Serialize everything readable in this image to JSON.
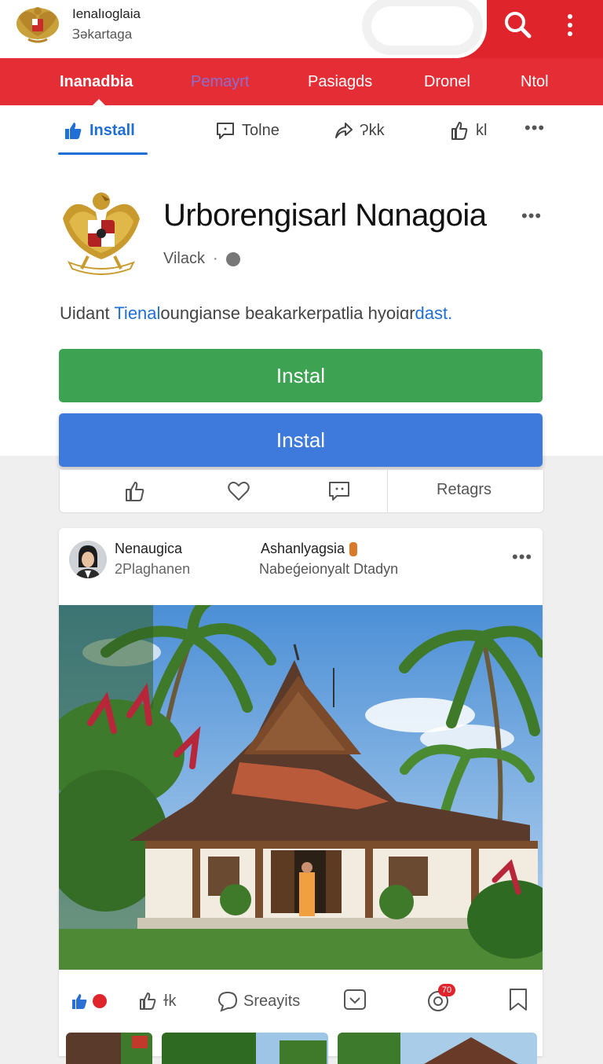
{
  "header": {
    "site_title": "Ienalıoglaia",
    "site_subtitle": "Ɜəkartaga"
  },
  "nav": {
    "items": [
      "Inanadbia",
      "Pemayrt",
      "Pasiagds",
      "Dronel",
      "Ntol"
    ]
  },
  "tabs": [
    {
      "label": "Install",
      "icon": "thumbs-up-icon"
    },
    {
      "label": "Tolne",
      "icon": "comment-icon"
    },
    {
      "label": "Ɂkk",
      "icon": "share-icon"
    },
    {
      "label": "kl",
      "icon": "thumbs-up-icon"
    }
  ],
  "profile": {
    "title": "Urborengisarl Nɑnagoia",
    "subtitle": "Vilack",
    "description_prefix": "Uidant ",
    "description_highlight": "Tienal",
    "description_middle": "oungianse beakarkerpatlia hyoiɑr",
    "description_suffix": "dast."
  },
  "buttons": {
    "install_primary": "Instal",
    "install_secondary": "Instal"
  },
  "action_bar": {
    "label": "Retagrs"
  },
  "post": {
    "author": "Nenaugica",
    "author_sub": "2Plaghanen",
    "co_author": "Ashanlyagsia",
    "co_sub": "Nabeǵeionyalt Dtadyn"
  },
  "reactions": {
    "like_label": "ɫk",
    "share_label": "Sreayits",
    "notification_count": "70"
  },
  "colors": {
    "brand_red": "#e0242c",
    "accent_blue": "#1f6fd6",
    "install_green": "#3da352",
    "install_blue": "#3e79dc"
  }
}
